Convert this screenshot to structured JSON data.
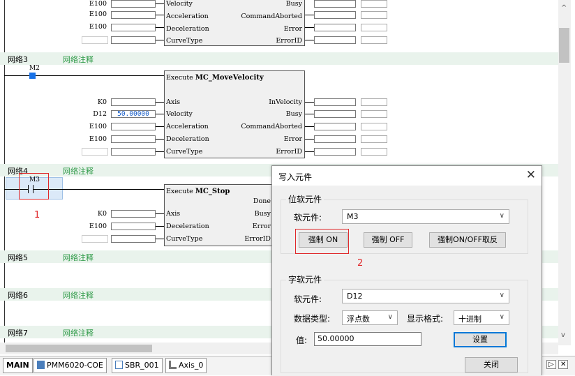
{
  "editor": {
    "net2_partial": {
      "operands": [
        "E100",
        "E100",
        "E100",
        ""
      ],
      "inputs": [
        "Velocity",
        "Acceleration",
        "Deceleration",
        "CurveType"
      ],
      "outputs": [
        "Busy",
        "CommandAborted",
        "Error",
        "ErrorID"
      ]
    },
    "net3": {
      "label": "网络3",
      "comment": "网络注释",
      "contact": "M2",
      "fb_execute": "Execute",
      "fb_name": "MC_MoveVelocity",
      "operands": [
        "K0",
        "D12",
        "E100",
        "E100",
        ""
      ],
      "inputs": [
        "Axis",
        "Velocity",
        "Acceleration",
        "Deceleration",
        "CurveType"
      ],
      "outputs": [
        "InVelocity",
        "Busy",
        "CommandAborted",
        "Error",
        "ErrorID"
      ],
      "velocity_value": "50.00000"
    },
    "net4": {
      "label": "网络4",
      "comment": "网络注释",
      "contact": "M3",
      "fb_execute": "Execute",
      "fb_name": "MC_Stop",
      "operands": [
        "K0",
        "E100",
        ""
      ],
      "inputs": [
        "Axis",
        "Deceleration",
        "CurveType"
      ],
      "outputs": [
        "Done",
        "Busy",
        "Error",
        "ErrorID"
      ]
    },
    "net5": {
      "label": "网络5",
      "comment": "网络注释"
    },
    "net6": {
      "label": "网络6",
      "comment": "网络注释"
    },
    "net7": {
      "label": "网络7",
      "comment": "网络注释"
    }
  },
  "annotations": {
    "marker1": "1",
    "marker2": "2"
  },
  "tabs": [
    {
      "label": "MAIN"
    },
    {
      "label": "PMM6020-COE"
    },
    {
      "label": "SBR_001"
    },
    {
      "label": "Axis_0"
    }
  ],
  "dialog": {
    "title": "写入元件",
    "bit_group": {
      "title": "位软元件",
      "element_label": "软元件:",
      "element_value": "M3",
      "force_on": "强制 ON",
      "force_off": "强制 OFF",
      "force_toggle": "强制ON/OFF取反"
    },
    "word_group": {
      "title": "字软元件",
      "element_label": "软元件:",
      "element_value": "D12",
      "datatype_label": "数据类型:",
      "datatype_value": "浮点数",
      "format_label": "显示格式:",
      "format_value": "十进制",
      "value_label": "值:",
      "value": "50.00000",
      "set_button": "设置"
    },
    "close_button": "关闭"
  },
  "colors": {
    "accent": "#0078d7",
    "annotation": "#e0282a",
    "comment": "#2e9a47",
    "value": "#1a5fc8"
  }
}
